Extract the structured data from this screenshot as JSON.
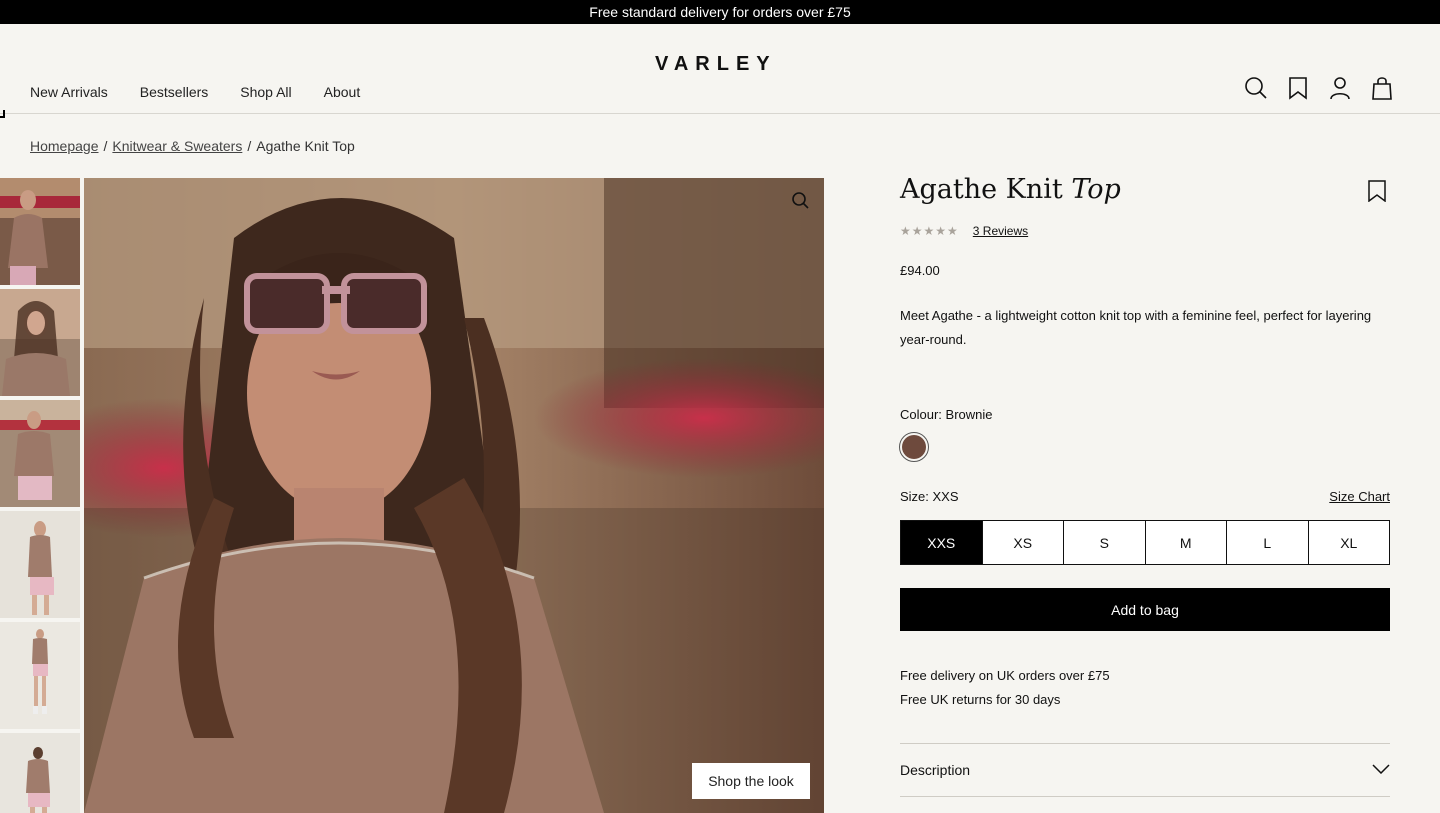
{
  "announcement": "Free standard delivery for orders over £75",
  "brand": "VARLEY",
  "nav": [
    "New Arrivals",
    "Bestsellers",
    "Shop All",
    "About"
  ],
  "header_icons": [
    "search-icon",
    "wishlist-icon",
    "account-icon",
    "bag-icon"
  ],
  "breadcrumb": {
    "home": "Homepage",
    "category": "Knitwear & Sweaters",
    "current": "Agathe Knit Top",
    "separator": "/"
  },
  "product": {
    "title_main": "Agathe Knit",
    "title_italic": "Top",
    "stars": "★★★★★",
    "reviews": "3 Reviews",
    "price": "£94.00",
    "description": "Meet Agathe - a lightweight cotton knit top with a feminine feel, perfect for layering year-round.",
    "colour_label": "Colour: Brownie",
    "colour_hex": "#6e4a3d",
    "size_label": "Size: XXS",
    "size_chart": "Size Chart",
    "sizes": [
      "XXS",
      "XS",
      "S",
      "M",
      "L",
      "XL"
    ],
    "selected_size": "XXS",
    "add_to_bag": "Add to bag",
    "delivery_line1": "Free delivery on UK orders over £75",
    "delivery_line2": "Free UK returns for 30 days",
    "accordion": "Description"
  },
  "gallery": {
    "shop_the_look": "Shop the look",
    "thumbnail_count": 6
  },
  "colors": {
    "accent": "#000000",
    "background": "#f6f5f1"
  }
}
